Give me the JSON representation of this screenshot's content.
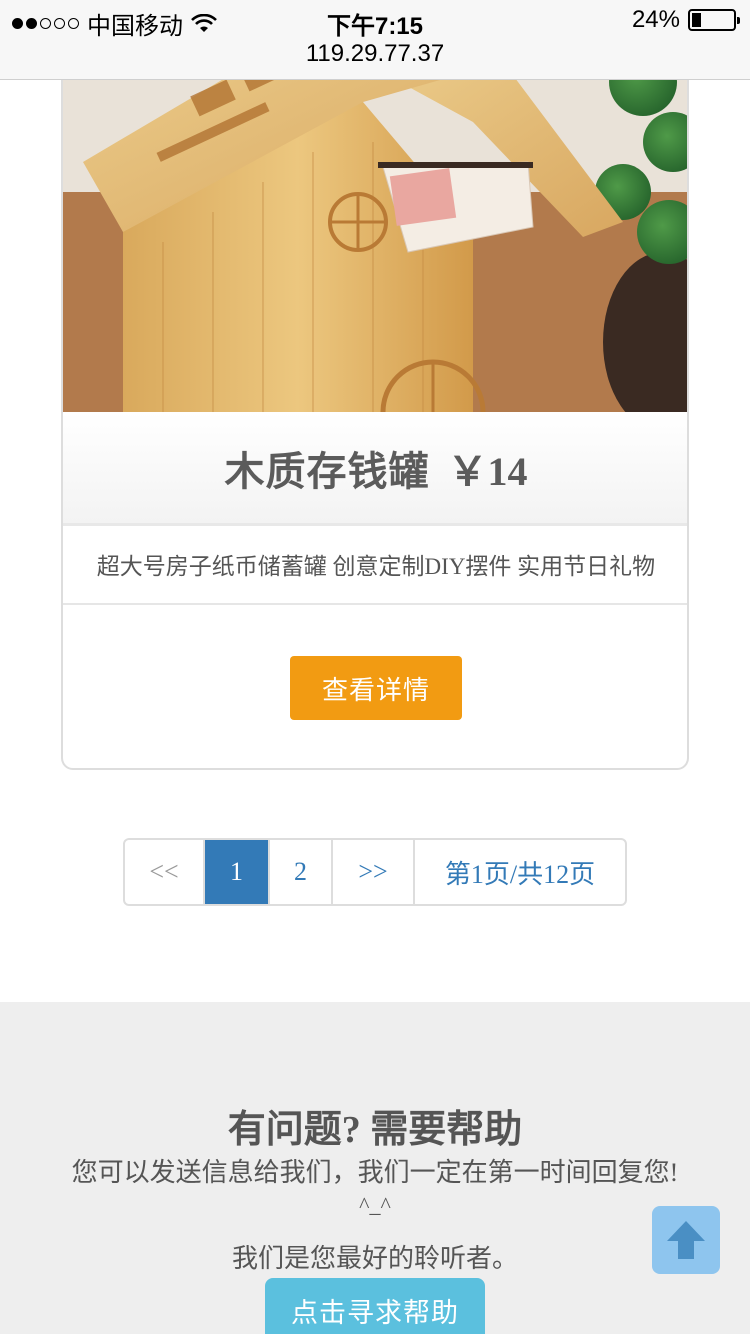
{
  "status_bar": {
    "carrier": "中国移动",
    "time": "下午7:15",
    "url": "119.29.77.37",
    "battery": "24%"
  },
  "product": {
    "title": "木质存钱罐",
    "price": "￥14",
    "description": "超大号房子纸币储蓄罐 创意定制DIY摆件 实用节日礼物",
    "detail_button": "查看详情",
    "image_icon": "wooden-house-piggy-bank-photo"
  },
  "pagination": {
    "prev": "<<",
    "pages": [
      "1",
      "2"
    ],
    "current": "1",
    "next": ">>",
    "info": "第1页/共12页"
  },
  "footer": {
    "title": "有问题? 需要帮助",
    "line1": "您可以发送信息给我们，我们一定在第一时间回复您!",
    "smile": "^_^",
    "line2": "我们是您最好的聆听者。",
    "help_button": "点击寻求帮助"
  },
  "colors": {
    "detail_button": "#f29b12",
    "pagination_active": "#337ab7",
    "help_button": "#5bc0de",
    "back_to_top": "#8ec5ee"
  }
}
